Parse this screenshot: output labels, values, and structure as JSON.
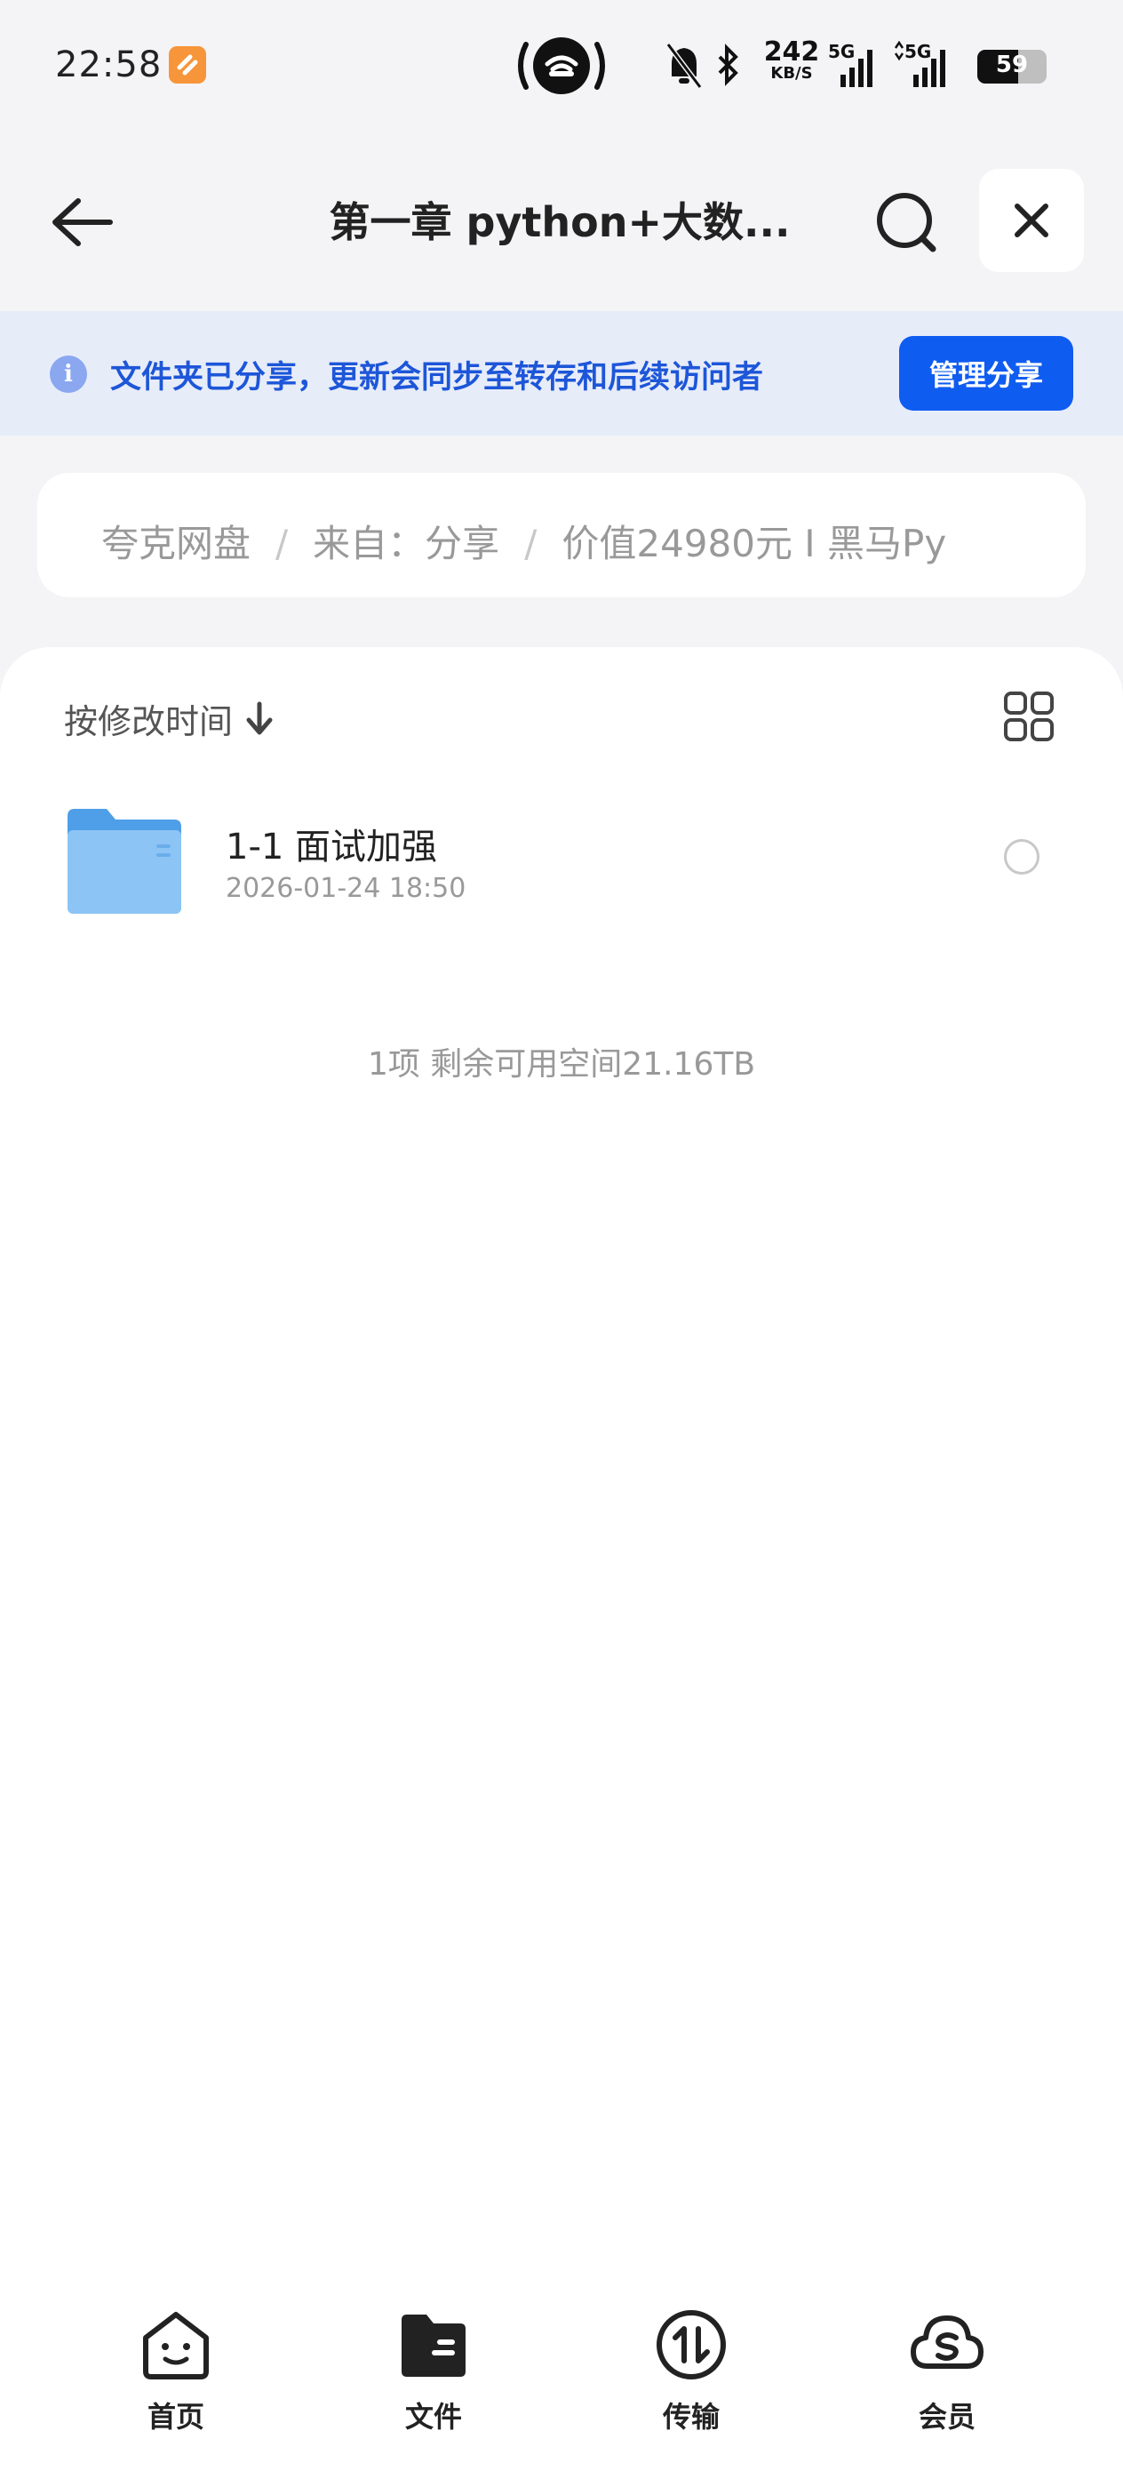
{
  "status_bar": {
    "time": "22:58",
    "net_speed_value": "242",
    "net_speed_unit": "KB/S",
    "signal_1": "5G",
    "signal_2": "5G",
    "battery": "59"
  },
  "header": {
    "title": "第一章 python+大数..."
  },
  "share_banner": {
    "text": "文件夹已分享，更新会同步至转存和后续访问者",
    "button_label": "管理分享"
  },
  "breadcrumb": {
    "items": [
      "夸克网盘",
      "来自：分享",
      "价值24980元 I 黑马Py"
    ]
  },
  "list": {
    "sort_label": "按修改时间"
  },
  "files": [
    {
      "name": "1-1 面试加强",
      "date": "2026-01-24 18:50"
    }
  ],
  "summary": "1项 剩余可用空间21.16TB",
  "bottom_nav": {
    "items": [
      {
        "label": "首页",
        "icon": "home-face-icon"
      },
      {
        "label": "文件",
        "icon": "folder-wallet-icon"
      },
      {
        "label": "传输",
        "icon": "transfer-icon"
      },
      {
        "label": "会员",
        "icon": "vip-cloud-icon"
      }
    ]
  }
}
